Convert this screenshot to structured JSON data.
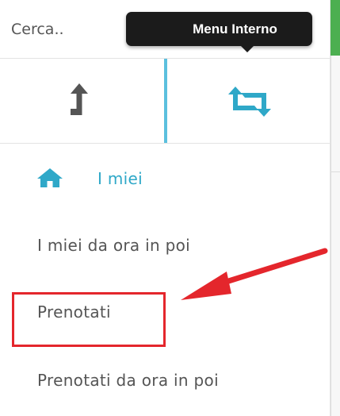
{
  "search": {
    "placeholder": "Cerca.."
  },
  "tooltip": {
    "text": "Menu Interno"
  },
  "mode_toggle": {
    "left_icon": "upload-arrow-icon",
    "right_icon": "retweet-icon",
    "active": "right"
  },
  "menu": {
    "items": [
      {
        "label": "I miei",
        "icon": "home-icon",
        "active": true
      },
      {
        "label": "I miei da ora in poi",
        "active": false
      },
      {
        "label": "Prenotati",
        "active": false,
        "highlighted": true
      },
      {
        "label": "Prenotati da ora in poi",
        "active": false
      }
    ]
  },
  "colors": {
    "accent": "#2fa8c8",
    "highlight": "#e4262c",
    "tooltip_bg": "#1b1b1b",
    "status_green": "#4caf50"
  }
}
